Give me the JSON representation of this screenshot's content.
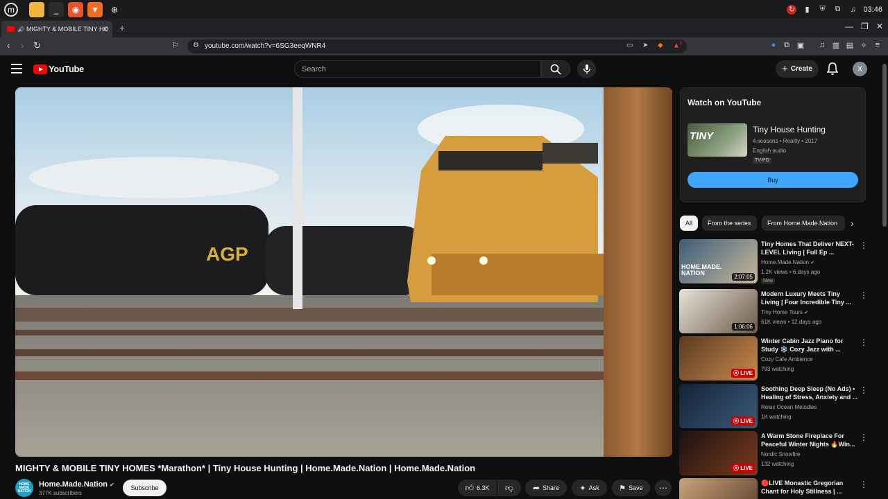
{
  "taskbar": {
    "clock": "03:46"
  },
  "browser": {
    "tab_title": "MIGHTY & MOBILE TINY HO",
    "url": "youtube.com/watch?v=6SG3eeqWNR4",
    "ext_badge": "2"
  },
  "header": {
    "logo_text": "YouTube",
    "search_placeholder": "Search",
    "create_label": "Create",
    "avatar_letter": "X"
  },
  "video": {
    "title": "MIGHTY & MOBILE TINY HOMES *Marathon* | Tiny House Hunting | Home.Made.Nation | Home.Made.Nation",
    "channel": "Home.Made.Nation",
    "channel_avatar_text": "HOME MADE NATION",
    "subscribers": "377K subscribers",
    "subscribe_label": "Subscribe",
    "like_count": "6.3K",
    "share_label": "Share",
    "ask_label": "Ask",
    "save_label": "Save"
  },
  "panel": {
    "heading": "Watch on YouTube",
    "thumb_text": "TINY",
    "show_title": "Tiny House Hunting",
    "show_meta": "4 seasons • Reality • 2017",
    "audio": "English audio",
    "rating": "TV-PG",
    "buy_label": "Buy"
  },
  "chips": [
    "All",
    "From the series",
    "From Home.Made.Nation"
  ],
  "recommendations": [
    {
      "title": "Tiny Homes That Deliver NEXT-LEVEL Living | Full Ep ...",
      "channel": "Home.Made.Nation",
      "meta": "1.2K views • 6 days ago",
      "badge": "New",
      "duration": "2:07:05",
      "thumb_text": "HOME.MADE. NATION",
      "colors": [
        "#3b5d7a",
        "#c9b79a"
      ]
    },
    {
      "title": "Modern Luxury Meets Tiny Living | Four Incredible Tiny ...",
      "channel": "Tiny Home Tours",
      "meta": "61K views • 12 days ago",
      "duration": "1:06:06",
      "colors": [
        "#e8e3da",
        "#6b5a48"
      ]
    },
    {
      "title": "Winter Cabin Jazz Piano for Study ❄️ Cozy Jazz with ...",
      "channel": "Cozy Cafe Ambience",
      "meta": "793 watching",
      "live": "LIVE",
      "colors": [
        "#5a3a22",
        "#c98a4a"
      ]
    },
    {
      "title": "Soothing Deep Sleep (No Ads) • Healing of Stress, Anxiety and ...",
      "channel": "Relax Ocean Melodies",
      "meta": "1K watching",
      "live": "LIVE",
      "colors": [
        "#122236",
        "#3c5a7a"
      ]
    },
    {
      "title": "A Warm Stone Fireplace For Peaceful Winter Nights 🔥Win...",
      "channel": "Nordic Snowfire",
      "meta": "132 watching",
      "live": "LIVE",
      "colors": [
        "#1a1210",
        "#7a3b1e"
      ]
    },
    {
      "title": "🔴LIVE Monastic Gregorian Chant for Holy Stillness | ...",
      "channel": "",
      "meta": "",
      "colors": [
        "#c9a57a",
        "#5a3a2a"
      ]
    }
  ]
}
